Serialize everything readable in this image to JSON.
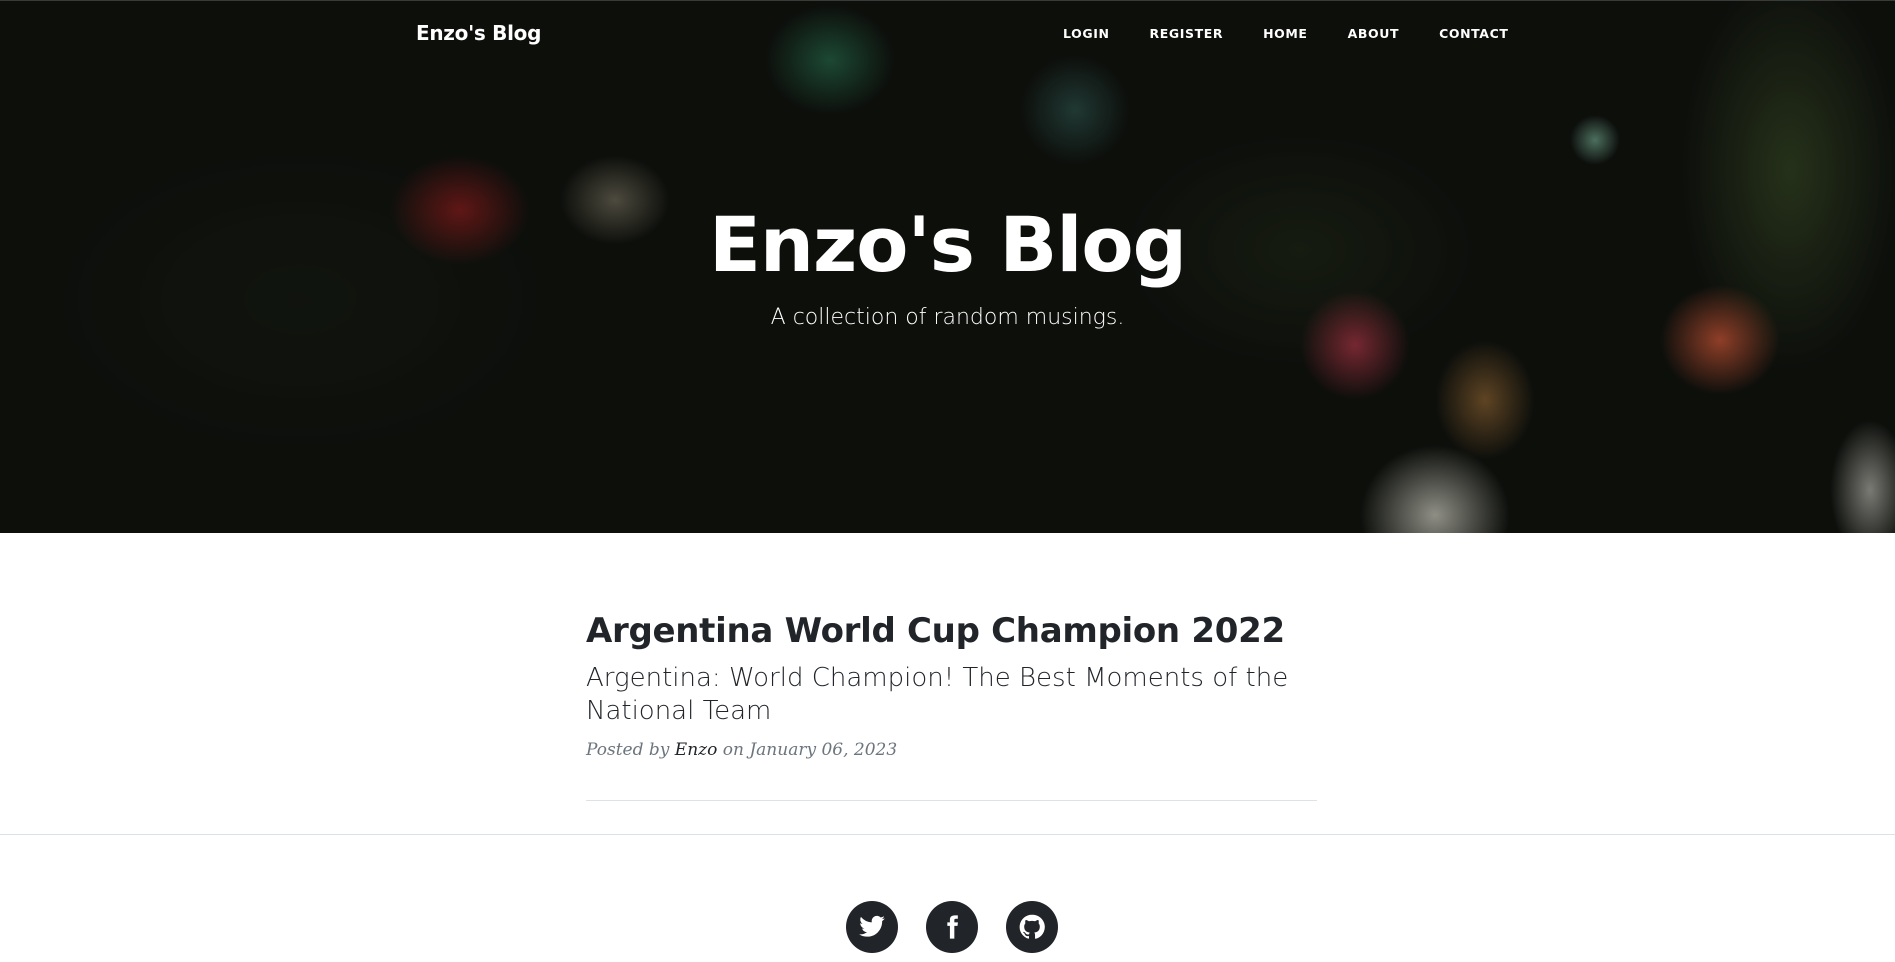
{
  "header": {
    "brand": "Enzo's Blog",
    "nav": {
      "login": "LOGIN",
      "register": "REGISTER",
      "home": "HOME",
      "about": "ABOUT",
      "contact": "CONTACT"
    }
  },
  "hero": {
    "title": "Enzo's Blog",
    "subtitle": "A collection of random musings."
  },
  "post": {
    "title": "Argentina World Cup Champion 2022",
    "subtitle": "Argentina: World Champion! The Best Moments of the National Team",
    "meta_prefix": "Posted by",
    "author": "Enzo",
    "meta_on": "on",
    "date": "January 06, 2023"
  },
  "footer": {
    "social": [
      {
        "icon": "twitter-icon"
      },
      {
        "icon": "facebook-icon"
      },
      {
        "icon": "github-icon"
      }
    ],
    "social_button_color": "#212529"
  }
}
